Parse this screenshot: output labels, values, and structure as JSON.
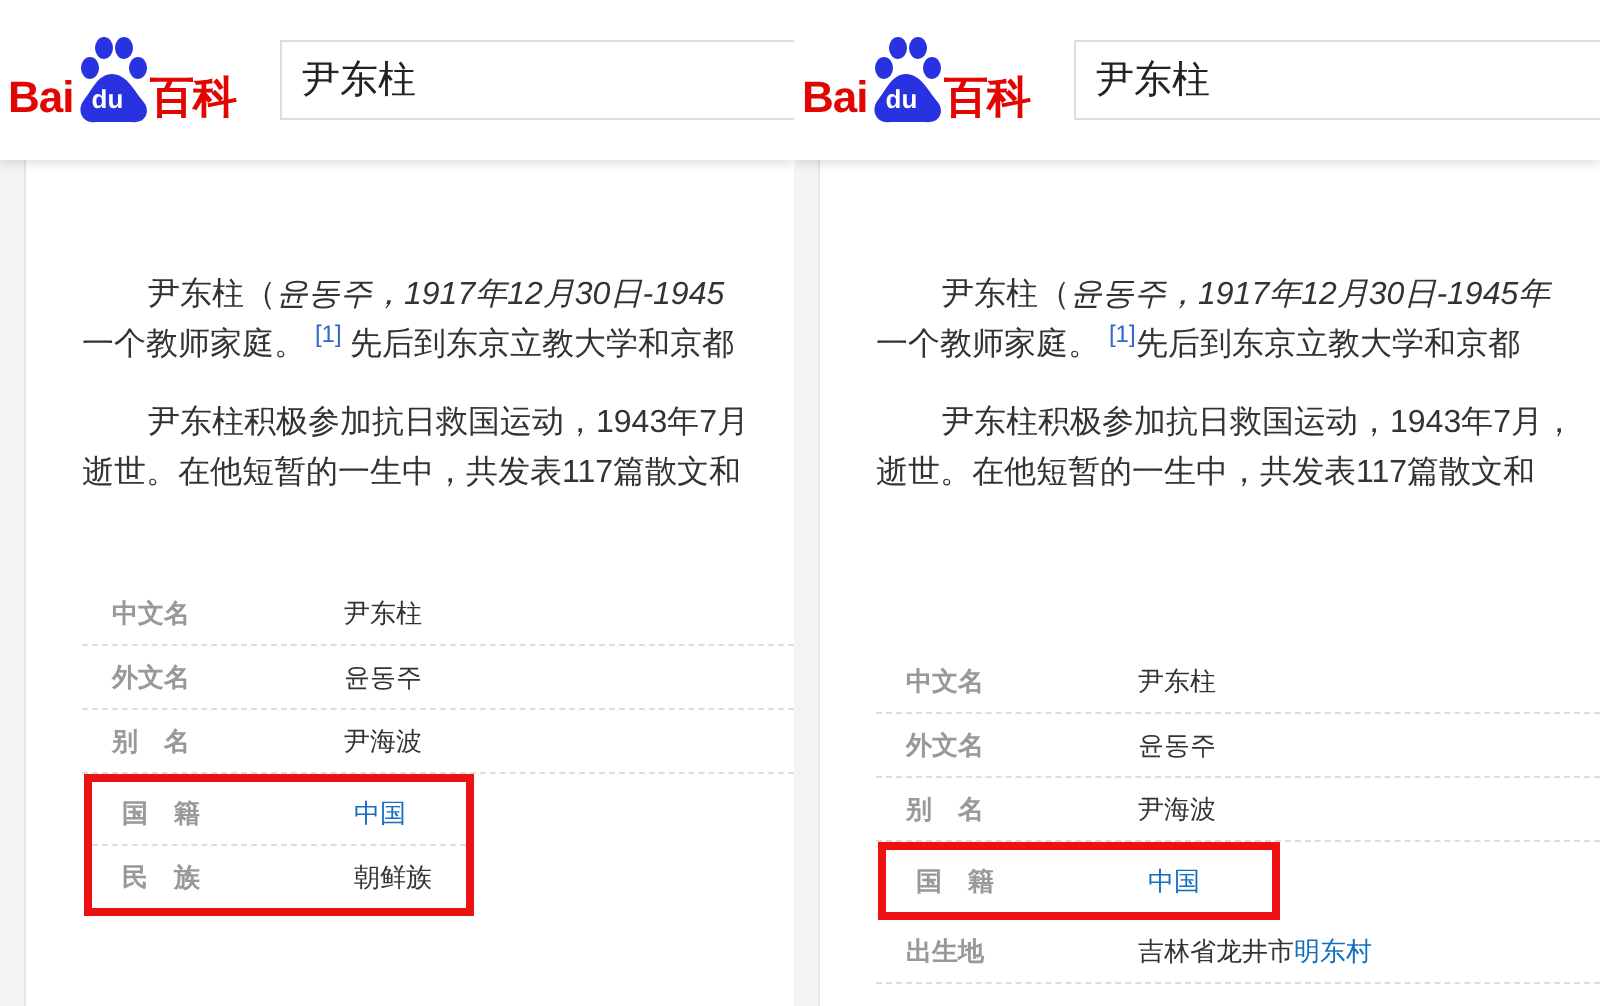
{
  "panels": [
    {
      "logo": {
        "left": "Bai",
        "paw": "du",
        "right": "百科"
      },
      "search": {
        "value": "尹东柱"
      },
      "paragraphs": [
        {
          "lines": [
            [
              {
                "text": "尹东柱（*윤동주，1917年12月30日-1945*"
              }
            ],
            [
              {
                "text": "一个教师家庭。 "
              },
              {
                "kind": "citation",
                "text": "[1]"
              },
              {
                "text": " 先后到东京立教大学和京都"
              }
            ]
          ]
        },
        {
          "lines": [
            [
              {
                "text": "尹东柱积极参加抗日救国运动，1943年7月"
              }
            ],
            [
              {
                "text": "逝世。在他短暂的一生中，共发表117篇散文和"
              }
            ]
          ]
        }
      ],
      "info": [
        {
          "label": "中文名",
          "value": [
            {
              "text": "尹东柱",
              "link": false
            }
          ],
          "highlighted": false
        },
        {
          "label": "外文名",
          "value": [
            {
              "text": "윤동주",
              "link": false
            }
          ],
          "highlighted": false
        },
        {
          "label": "别　名",
          "value": [
            {
              "text": "尹海波",
              "link": false
            }
          ],
          "highlighted": false
        },
        {
          "label": "国　籍",
          "value": [
            {
              "text": "中国",
              "link": true
            }
          ],
          "highlighted": true
        },
        {
          "label": "民　族",
          "value": [
            {
              "text": "朝鲜族",
              "link": false
            }
          ],
          "highlighted": true
        }
      ]
    },
    {
      "logo": {
        "left": "Bai",
        "paw": "du",
        "right": "百科"
      },
      "search": {
        "value": "尹东柱"
      },
      "paragraphs": [
        {
          "lines": [
            [
              {
                "text": "尹东柱（*윤동주，1917年12月30日-1945年*"
              }
            ],
            [
              {
                "text": "一个教师家庭。 "
              },
              {
                "kind": "citation",
                "text": "[1]"
              },
              {
                "text": "先后到东京立教大学和京都"
              }
            ]
          ]
        },
        {
          "lines": [
            [
              {
                "text": "尹东柱积极参加抗日救国运动，1943年7月，"
              }
            ],
            [
              {
                "text": "逝世。在他短暂的一生中，共发表117篇散文和"
              }
            ]
          ]
        }
      ],
      "info": [
        {
          "label": "中文名",
          "value": [
            {
              "text": "尹东柱",
              "link": false
            }
          ],
          "highlighted": false
        },
        {
          "label": "外文名",
          "value": [
            {
              "text": "윤동주",
              "link": false
            }
          ],
          "highlighted": false
        },
        {
          "label": "别　名",
          "value": [
            {
              "text": "尹海波",
              "link": false
            }
          ],
          "highlighted": false
        },
        {
          "label": "国　籍",
          "value": [
            {
              "text": "中国",
              "link": true
            }
          ],
          "highlighted": true
        },
        {
          "label": "出生地",
          "value": [
            {
              "text": "吉林省龙井市",
              "link": false
            },
            {
              "text": "明东村",
              "link": true
            }
          ],
          "highlighted": false
        }
      ]
    }
  ]
}
